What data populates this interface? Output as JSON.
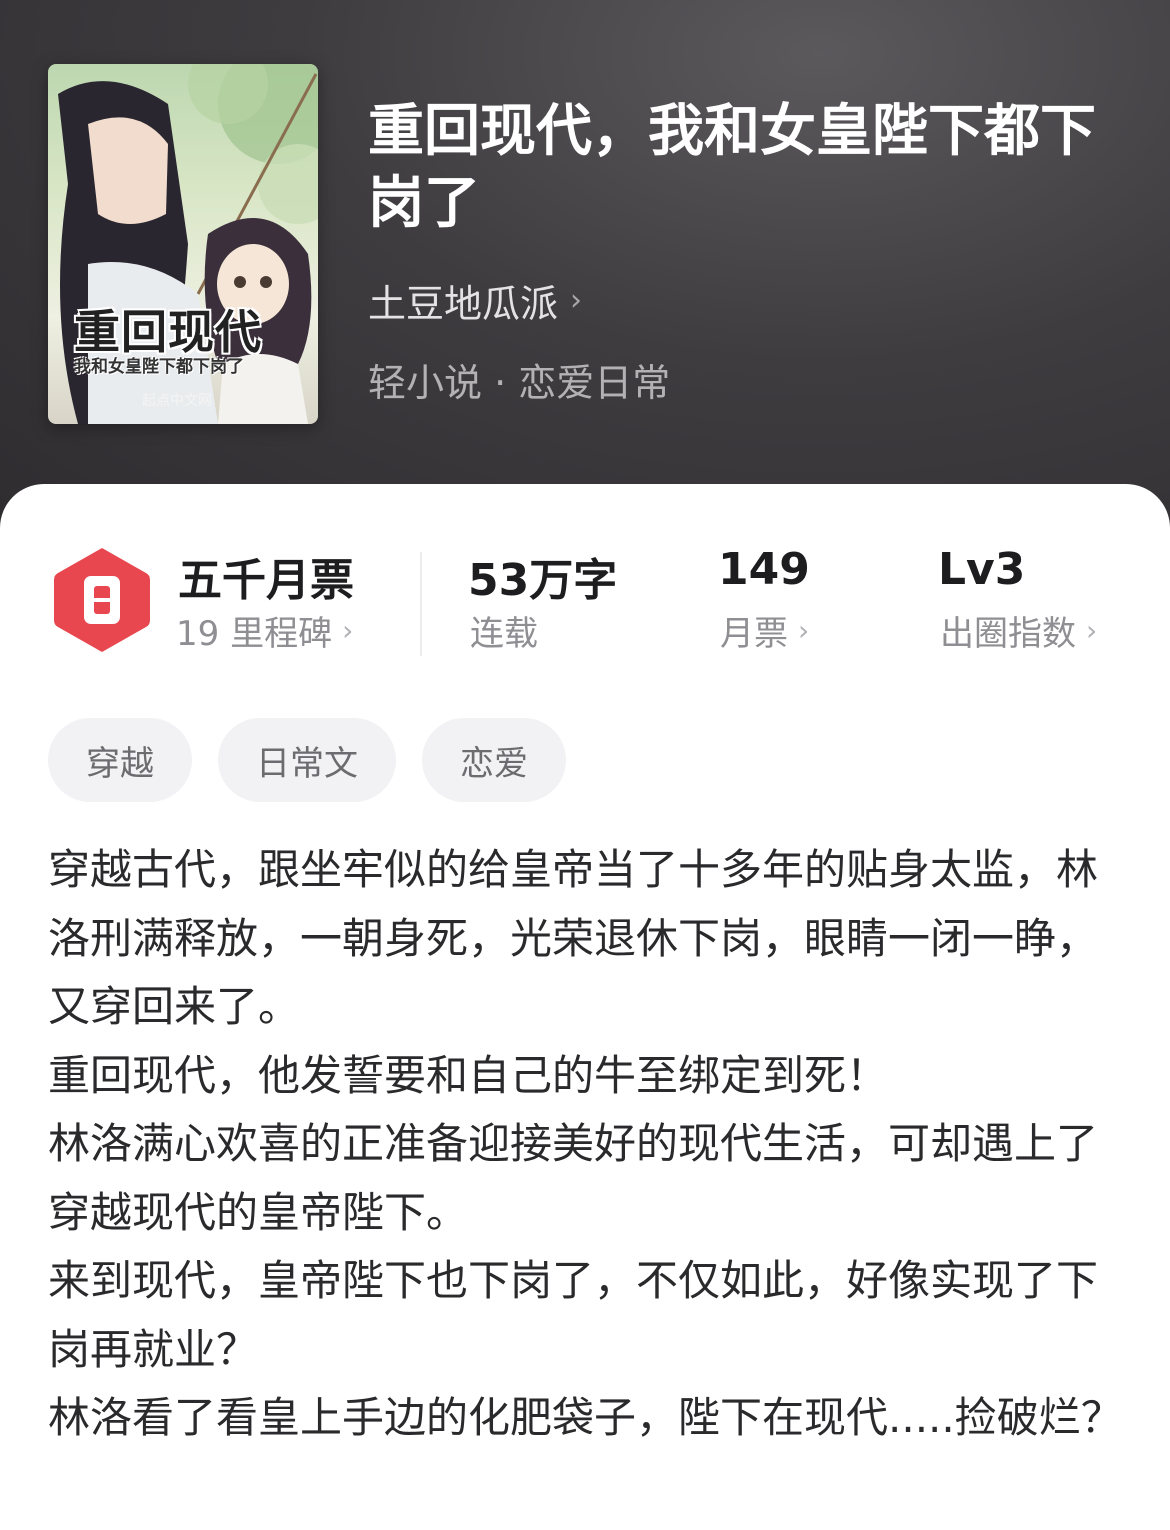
{
  "book": {
    "title": "重回现代，我和女皇陛下都下岗了",
    "author": "土豆地瓜派",
    "genre": "轻小说 · 恋爱日常"
  },
  "cover": {
    "author_mark": "土豆地瓜派",
    "title": "重回现代",
    "subtitle": "我和女皇陛下都下岗了",
    "publisher": "起点中文网"
  },
  "stats": {
    "milestone": {
      "title": "五千月票",
      "sub": "19 里程碑"
    },
    "words": {
      "value": "53万字",
      "label": "连载"
    },
    "tickets": {
      "value": "149",
      "label": "月票"
    },
    "index": {
      "value": "Lv3",
      "label": "出圈指数"
    }
  },
  "tags": [
    "穿越",
    "日常文",
    "恋爱"
  ],
  "description": [
    "穿越古代，跟坐牢似的给皇帝当了十多年的贴身太监，林洛刑满释放，一朝身死，光荣退休下岗，眼睛一闭一睁，又穿回来了。",
    "重回现代，他发誓要和自己的牛至绑定到死！",
    "林洛满心欢喜的正准备迎接美好的现代生活，可却遇上了穿越现代的皇帝陛下。",
    "来到现代，皇帝陛下也下岗了，不仅如此，好像实现了下岗再就业？",
    "林洛看了看皇上手边的化肥袋子，陛下在现代.....捡破烂？"
  ],
  "colors": {
    "header_bg": "#2f2d30",
    "badge_red": "#e8474f",
    "card_bg": "#ffffff",
    "tag_bg": "#f2f2f4"
  },
  "icons": {
    "chevron": "chevron-right-icon",
    "badge": "ticket-badge-icon"
  }
}
